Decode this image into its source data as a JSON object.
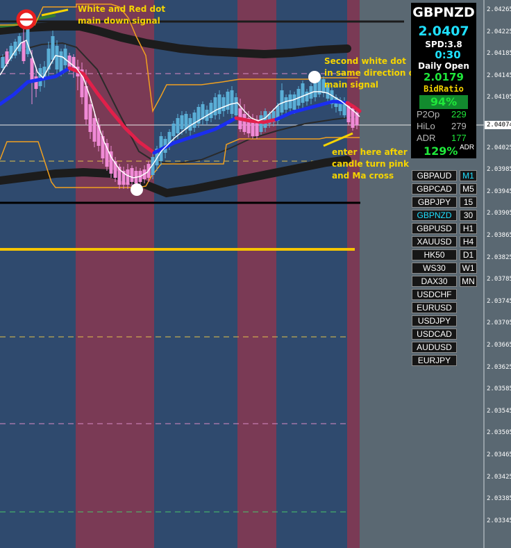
{
  "chart": {
    "symbol": "GBPNZD",
    "timeframe": "M30",
    "colors": {
      "background": "#5a6872",
      "session_blue": "#2f4a6e",
      "session_red": "#7a3a55",
      "candle_up": "#5aaed6",
      "candle_down": "#f08ad6",
      "ma_rising": "#1a2ef0",
      "ma_falling": "#e0204a",
      "ma_fast": "#ffffff",
      "envelope": "#f0a020",
      "slow_band": "#1c1c1c",
      "annotation": "#f5d400"
    },
    "price_scale": {
      "labels": [
        "2.04265",
        "2.04225",
        "2.04185",
        "2.04145",
        "2.04105",
        "2.04074",
        "2.04025",
        "2.03985",
        "2.03945",
        "2.03905",
        "2.03865",
        "2.03825",
        "2.03785",
        "2.03745",
        "2.03705",
        "2.03665",
        "2.03625",
        "2.03585",
        "2.03545",
        "2.03505",
        "2.03465",
        "2.03425",
        "2.03385",
        "2.03345"
      ],
      "current_price_tag": "2.04074"
    },
    "annotations": {
      "top_left": "White and Red dot\nmain down signal",
      "right_signal": "Second white dot\nin same direction of\nmain signal",
      "entry_note": "enter here after\ncandle turn pink\nand Ma cross"
    }
  },
  "info_panel": {
    "symbol": "GBPNZD",
    "price": "2.0407",
    "spread": "SPD:3.8",
    "timer": "0:30",
    "daily_open_label": "Daily Open",
    "daily_open_value": "2.0179",
    "bid_ratio_label": "BidRatio",
    "bid_ratio_value": "94%",
    "stats": [
      {
        "label": "P2Op",
        "value": "229"
      },
      {
        "label": "HiLo",
        "value": "279"
      },
      {
        "label": "ADR",
        "value": "177"
      }
    ],
    "adr_percent": "129%",
    "adr_suffix": "ADR"
  },
  "symbol_buttons": [
    "GBPAUD",
    "GBPCAD",
    "GBPJPY",
    "GBPNZD",
    "GBPUSD",
    "XAUUSD",
    "HK50",
    "WS30",
    "DAX30",
    "USDCHF",
    "EURUSD",
    "USDJPY",
    "USDCAD",
    "AUDUSD",
    "EURJPY"
  ],
  "active_symbol": "GBPNZD",
  "timeframe_buttons": [
    "M1",
    "M5",
    "15",
    "30",
    "H1",
    "H4",
    "D1",
    "W1",
    "MN"
  ],
  "active_timeframe": "M1"
}
